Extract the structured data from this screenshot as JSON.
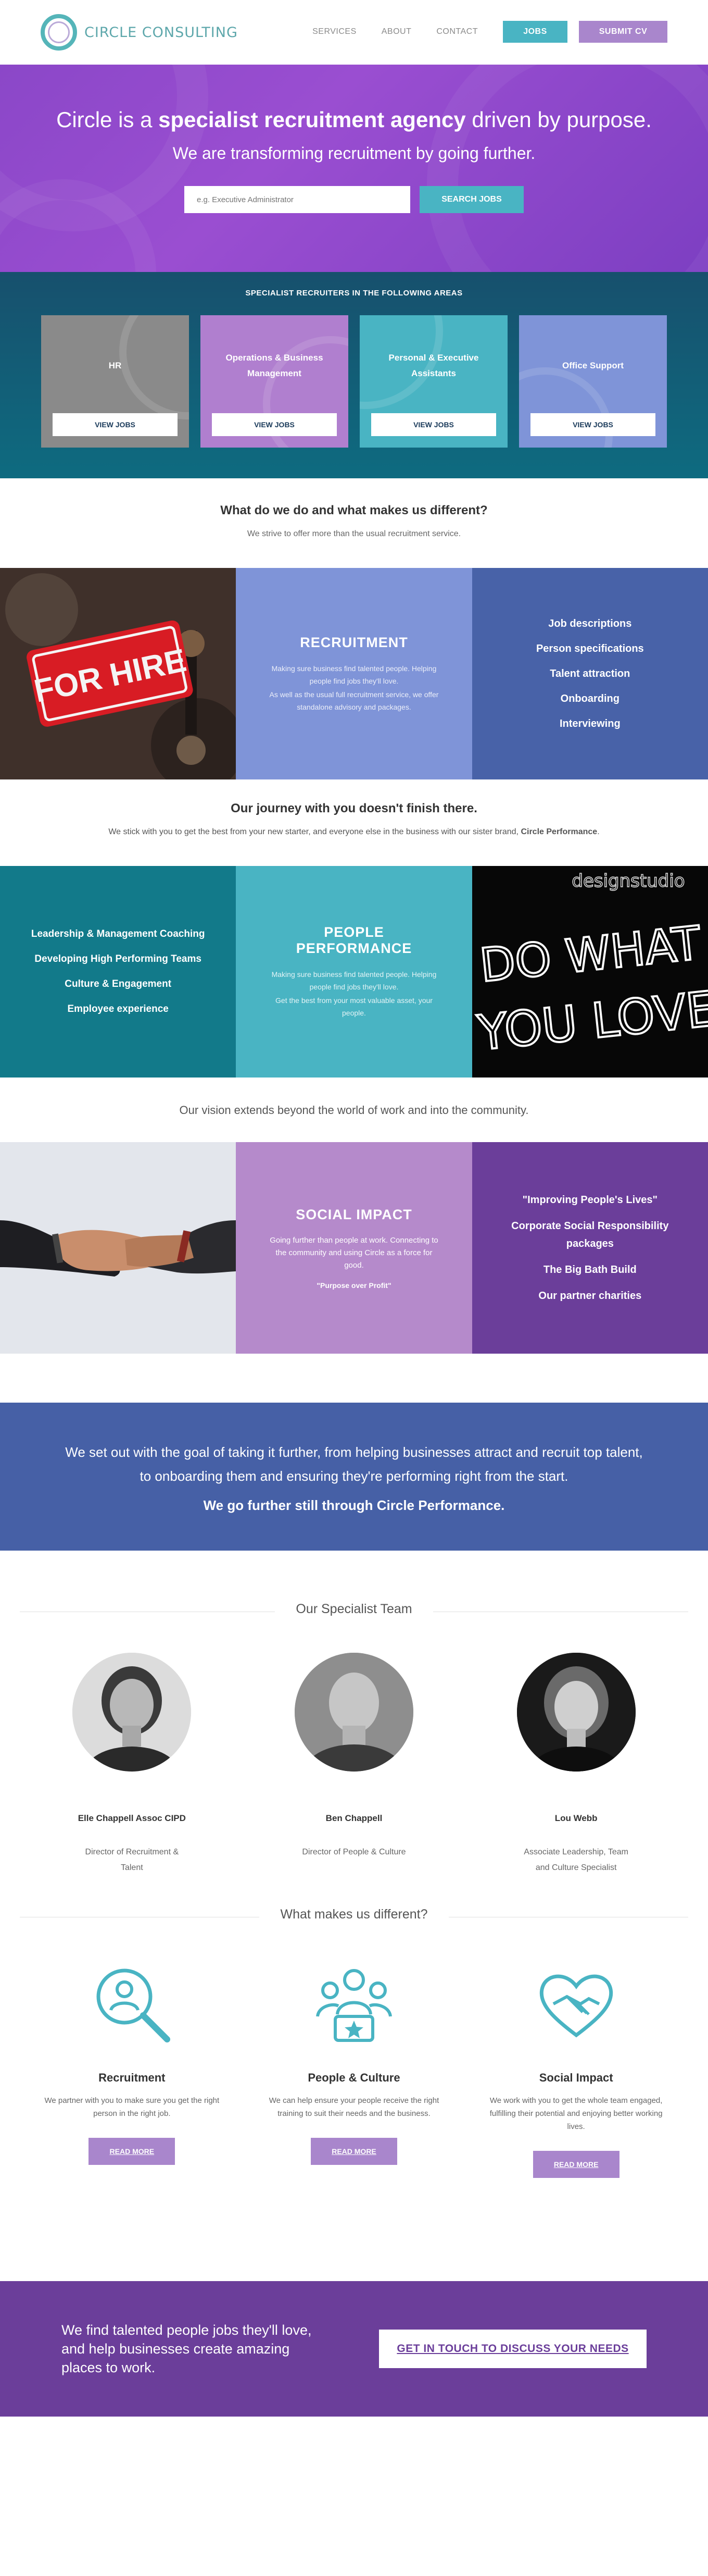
{
  "header": {
    "logo_text": "CIRCLE CONSULTING",
    "nav": [
      "SERVICES",
      "ABOUT",
      "CONTACT"
    ],
    "jobs_button": "JOBS",
    "cv_button": "SUBMIT CV"
  },
  "hero": {
    "headline_pre": "Circle is a ",
    "headline_bold": "specialist recruitment agency",
    "headline_post": " driven by purpose.",
    "subheadline": "We are transforming recruitment by going further.",
    "search_placeholder": "e.g. Executive Administrator",
    "search_button": "SEARCH JOBS"
  },
  "areas": {
    "title": "SPECIALIST RECRUITERS IN THE FOLLOWING AREAS",
    "cards": [
      {
        "title": "HR",
        "button": "VIEW JOBS",
        "color": "#8a8a8a"
      },
      {
        "title": "Operations & Business Management",
        "button": "VIEW JOBS",
        "color": "#b07fcf"
      },
      {
        "title": "Personal & Executive Assistants",
        "button": "VIEW JOBS",
        "color": "#49b4c3"
      },
      {
        "title": "Office Support",
        "button": "VIEW JOBS",
        "color": "#7f94d8"
      }
    ]
  },
  "intro": {
    "title": "What do we do and what makes us different?",
    "text": "We strive to offer more than the usual recruitment service."
  },
  "recruitment": {
    "image_text": "FOR HIRE",
    "title": "RECRUITMENT",
    "text1": "Making sure business find talented people. Helping people find jobs they'll love.",
    "text2": "As well as the usual full recruitment service, we offer standalone advisory and packages.",
    "list": [
      "Job descriptions",
      "Person specifications",
      "Talent attraction",
      "Onboarding",
      "Interviewing"
    ]
  },
  "journey": {
    "title": "Our journey with you doesn't finish there.",
    "text": "We stick with you to get the best from your new starter, and everyone else in the business with our sister brand,",
    "brand": "Circle Performance",
    "period": "."
  },
  "performance": {
    "list": [
      "Leadership & Management Coaching",
      "Developing High Performing Teams",
      "Culture & Engagement",
      "Employee experience"
    ],
    "title": "PEOPLE PERFORMANCE",
    "text1": "Making sure business find talented people. Helping people find jobs they'll love.",
    "text2": "Get the best from your most valuable asset, your people.",
    "image_text_top": "designstudio",
    "image_text_1": "DO WHAT",
    "image_text_2": "YOU LOVE"
  },
  "vision": {
    "text": "Our vision extends beyond the world of work and into the community."
  },
  "social": {
    "title": "SOCIAL IMPACT",
    "text": "Going further than people at work. Connecting to the community and using Circle as a force for good.",
    "quote": "\"Purpose over Profit\"",
    "list": [
      "\"Improving People's Lives\"",
      "Corporate Social Responsibility packages",
      "The Big Bath Build",
      "Our partner charities"
    ]
  },
  "statement": {
    "text": "We set out with the goal of taking it further, from helping businesses attract and recruit top talent, to onboarding them and ensuring they're performing right from the start.",
    "strong": "We go further still through Circle Performance."
  },
  "team": {
    "title": "Our Specialist Team",
    "members": [
      {
        "name": "Elle Chappell Assoc CIPD",
        "role": "Director of Recruitment & Talent"
      },
      {
        "name": "Ben Chappell",
        "role": "Director of People & Culture"
      },
      {
        "name": "Lou Webb",
        "role": "Associate Leadership, Team and Culture Specialist"
      }
    ]
  },
  "difference": {
    "title": "What makes us different?",
    "items": [
      {
        "title": "Recruitment",
        "text": "We partner with you to make sure you get the right person in the right job.",
        "button": "READ MORE",
        "icon": "search-person-icon"
      },
      {
        "title": "People & Culture",
        "text": "We can help ensure your people receive the right training to suit their needs and the business.",
        "button": "READ MORE",
        "icon": "team-star-icon"
      },
      {
        "title": "Social Impact",
        "text": "We work with you to get the whole team engaged, fulfilling their potential and enjoying better working lives.",
        "button": "READ MORE",
        "icon": "heart-handshake-icon"
      }
    ]
  },
  "cta": {
    "text": "We find talented people jobs they'll love, and help businesses create amazing places to work.",
    "button": "GET IN TOUCH TO DISCUSS YOUR NEEDS"
  },
  "colors": {
    "teal": "#49b4c3",
    "purple": "#a986cc",
    "hero_purple": "#8b47c8",
    "navy_blue": "#4660a6",
    "cta_purple": "#6b3e9a"
  }
}
